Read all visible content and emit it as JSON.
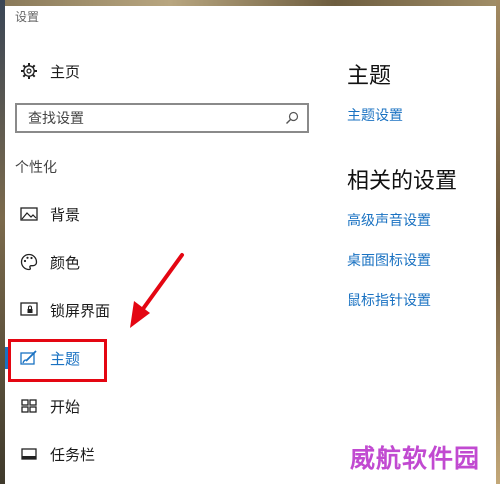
{
  "window": {
    "title": "设置"
  },
  "nav": {
    "home": {
      "label": "主页",
      "icon": "gear-icon"
    },
    "search": {
      "placeholder": "查找设置",
      "icon": "search-icon"
    },
    "section_label": "个性化",
    "items": [
      {
        "label": "背景",
        "icon": "picture-icon",
        "active": false
      },
      {
        "label": "颜色",
        "icon": "palette-icon",
        "active": false
      },
      {
        "label": "锁屏界面",
        "icon": "lock-screen-icon",
        "active": false
      },
      {
        "label": "主题",
        "icon": "theme-brush-icon",
        "active": true
      },
      {
        "label": "开始",
        "icon": "start-icon",
        "active": false
      },
      {
        "label": "任务栏",
        "icon": "taskbar-icon",
        "active": false
      }
    ]
  },
  "main": {
    "heading": "主题",
    "theme_settings_link": "主题设置",
    "related_heading": "相关的设置",
    "related_links": [
      "高级声音设置",
      "桌面图标设置",
      "鼠标指针设置"
    ]
  },
  "annotation": {
    "arrow_color": "#e40612",
    "box_color": "#e40612"
  },
  "watermark": "威航软件园",
  "colors": {
    "accent": "#1a72c2",
    "text": "#1b1b1b"
  }
}
